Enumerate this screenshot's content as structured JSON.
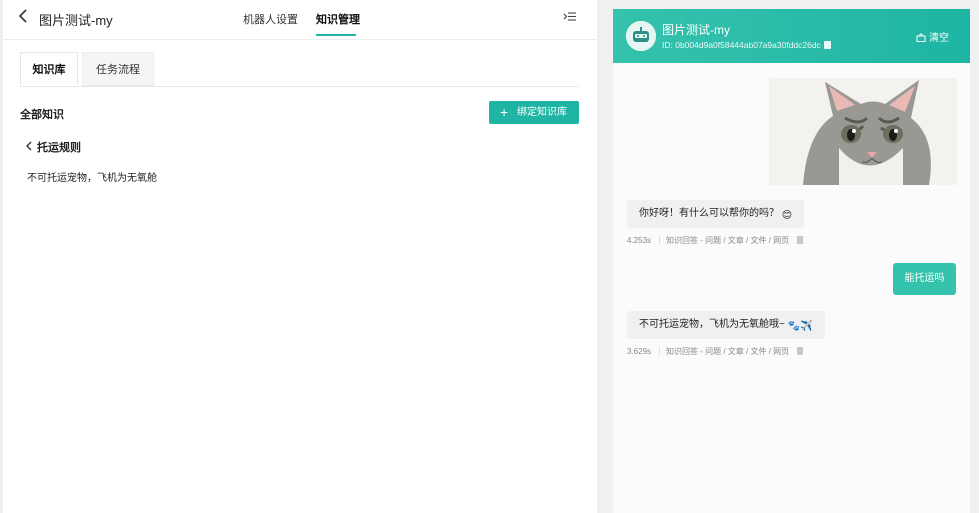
{
  "header": {
    "title": "图片测试-my",
    "tabs": [
      "机器人设置",
      "知识管理"
    ],
    "active_tab": "知识管理"
  },
  "subtabs": [
    "知识库",
    "任务流程"
  ],
  "knowledge": {
    "section_title": "全部知识",
    "bind_button": "绑定知识库",
    "breadcrumb": "托运规则",
    "content": "不可托运宠物，飞机为无氧舱"
  },
  "chat": {
    "bot_name": "图片测试-my",
    "bot_id": "ID: 0b004d9a0f58444ab07a9a30fddc26dc",
    "clear_label": "清空",
    "messages": [
      {
        "role": "user",
        "type": "image",
        "alt": "kitten photo"
      },
      {
        "role": "bot",
        "text": "你好呀！有什么可以帮你的吗？",
        "emoji": "😊",
        "time": "4.253s",
        "source": "知识回答 - 问题 / 文章 / 文件 / 网页"
      },
      {
        "role": "user",
        "text": "能托运吗"
      },
      {
        "role": "bot",
        "text": "不可托运宠物，飞机为无氧舱哦~",
        "emoji": "🐾✈️",
        "time": "3.629s",
        "source": "知识回答 - 问题 / 文章 / 文件 / 网页"
      }
    ]
  },
  "colors": {
    "accent": "#1fb5a5",
    "header_gradient_start": "#36c2ad",
    "header_gradient_end": "#1eb5a3"
  }
}
